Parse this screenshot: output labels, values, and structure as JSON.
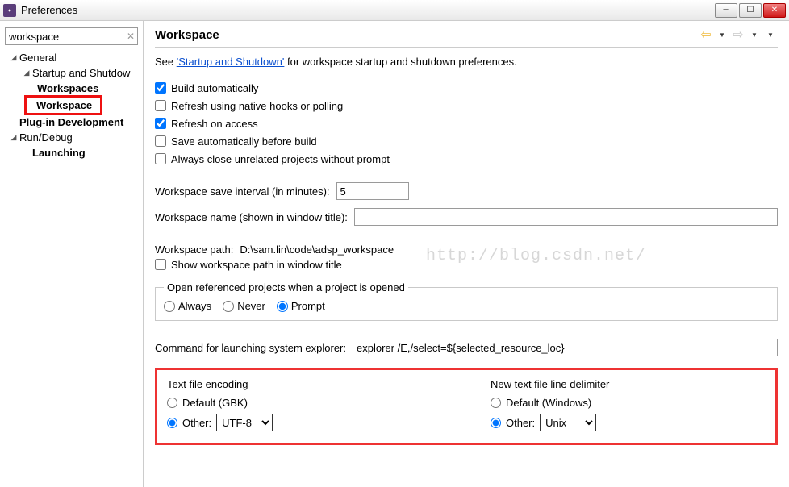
{
  "window": {
    "title": "Preferences"
  },
  "sidebar": {
    "filter_value": "workspace",
    "items": [
      {
        "label": "General",
        "expanded": true,
        "lvl": 1
      },
      {
        "label": "Startup and Shutdow",
        "expanded": true,
        "lvl": 2
      },
      {
        "label": "Workspaces",
        "lvl": 3,
        "bold": true
      },
      {
        "label": "Workspace",
        "lvl": 2,
        "bold": true,
        "selected": true
      },
      {
        "label": "Plug-in Development",
        "lvl": 1,
        "bold": true
      },
      {
        "label": "Run/Debug",
        "expanded": true,
        "lvl": 1
      },
      {
        "label": "Launching",
        "lvl": 2,
        "bold": true
      }
    ]
  },
  "main": {
    "heading": "Workspace",
    "intro_pre": "See ",
    "intro_link": "'Startup and Shutdown'",
    "intro_post": " for workspace startup and shutdown preferences.",
    "checks": [
      {
        "label": "Build automatically",
        "checked": true
      },
      {
        "label": "Refresh using native hooks or polling",
        "checked": false
      },
      {
        "label": "Refresh on access",
        "checked": true
      },
      {
        "label": "Save automatically before build",
        "checked": false
      },
      {
        "label": "Always close unrelated projects without prompt",
        "checked": false
      }
    ],
    "save_interval_label": "Workspace save interval (in minutes):",
    "save_interval_value": "5",
    "workspace_name_label": "Workspace name (shown in window title):",
    "workspace_name_value": "",
    "workspace_path_label": "Workspace path:",
    "workspace_path_value": "D:\\sam.lin\\code\\adsp_workspace",
    "show_path_label": "Show workspace path in window title",
    "ref_projects_legend": "Open referenced projects when a project is opened",
    "ref_options": [
      {
        "label": "Always",
        "checked": false
      },
      {
        "label": "Never",
        "checked": false
      },
      {
        "label": "Prompt",
        "checked": true
      }
    ],
    "explorer_label": "Command for launching system explorer:",
    "explorer_value": "explorer /E,/select=${selected_resource_loc}",
    "encoding": {
      "heading": "Text file encoding",
      "default_label": "Default (GBK)",
      "other_label": "Other:",
      "other_value": "UTF-8",
      "selected": "other"
    },
    "delimiter": {
      "heading": "New text file line delimiter",
      "default_label": "Default (Windows)",
      "other_label": "Other:",
      "other_value": "Unix",
      "selected": "other"
    }
  },
  "watermark": "http://blog.csdn.net/"
}
